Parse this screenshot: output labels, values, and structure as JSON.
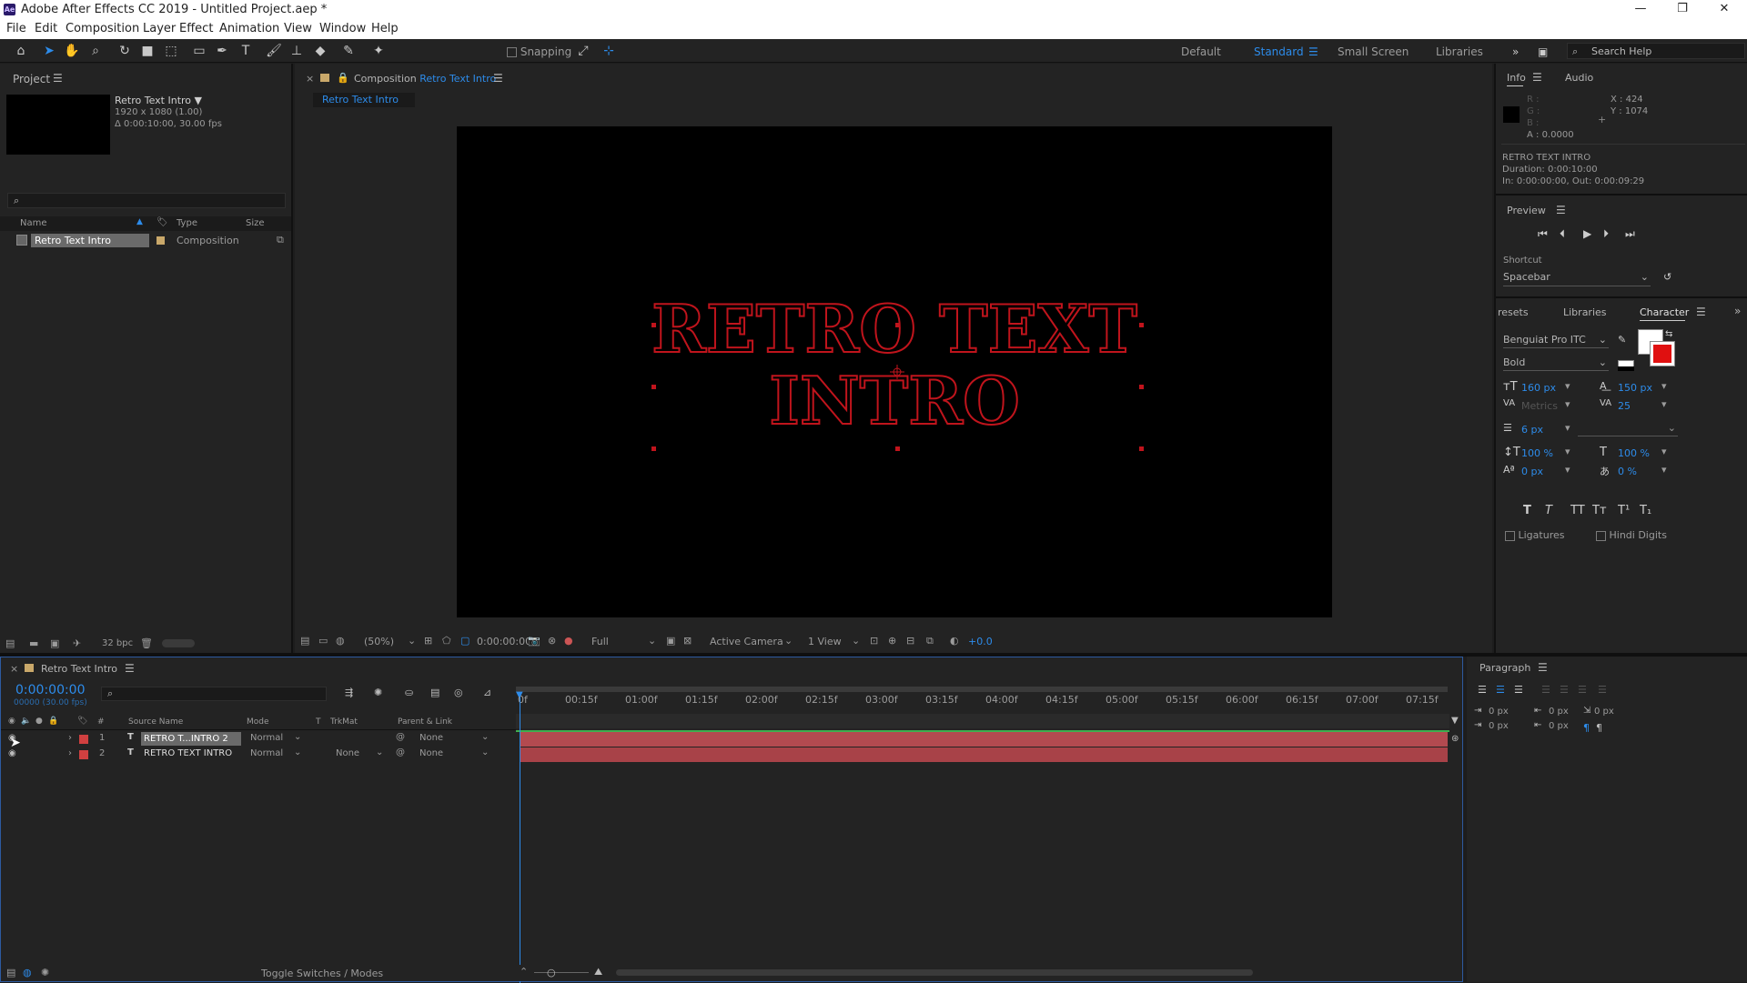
{
  "title_bar": {
    "logo": "Ae",
    "title": "Adobe After Effects CC 2019 - Untitled Project.aep *",
    "minimize": "—",
    "maximize": "❐",
    "close": "✕"
  },
  "menu": [
    "File",
    "Edit",
    "Composition",
    "Layer",
    "Effect",
    "Animation",
    "View",
    "Window",
    "Help"
  ],
  "toolbar": {
    "snapping": "Snapping",
    "workspaces": [
      "Default",
      "Standard",
      "Small Screen",
      "Libraries"
    ],
    "active_workspace": "Standard",
    "search_placeholder": "Search Help",
    "more": "»"
  },
  "project": {
    "tab": "Project",
    "item_name": "Retro Text Intro ▼",
    "item_res": "1920 x 1080 (1.00)",
    "item_dur": "Δ 0:00:10:00, 30.00 fps",
    "columns": {
      "name": "Name",
      "type": "Type",
      "size": "Size"
    },
    "rows": [
      {
        "name": "Retro Text Intro",
        "type": "Composition"
      }
    ],
    "bpc": "32 bpc"
  },
  "composition": {
    "tab_prefix": "Composition",
    "tab_name": "Retro Text Intro",
    "breadcrumb": "Retro Text Intro",
    "text_line1": "RETRO TEXT",
    "text_line2": "INTRO",
    "text_color": "#c0141c",
    "zoom": "(50%)",
    "timecode": "0:00:00:00",
    "resolution": "Full",
    "camera": "Active Camera",
    "views": "1 View",
    "exposure": "+0.0"
  },
  "info": {
    "tabs": [
      "Info",
      "Audio"
    ],
    "r": "R :",
    "g": "G :",
    "b": "B :",
    "a": "A : 0.0000",
    "x": "X : 424",
    "y": "Y : 1074",
    "comp_name": "RETRO TEXT INTRO",
    "duration": "Duration: 0:00:10:00",
    "inout": "In: 0:00:00:00, Out: 0:00:09:29"
  },
  "preview": {
    "tab": "Preview",
    "shortcut_label": "Shortcut",
    "shortcut_value": "Spacebar"
  },
  "character": {
    "tabs": [
      "resets",
      "Libraries",
      "Character"
    ],
    "font": "Benguiat Pro ITC",
    "style": "Bold",
    "size": "160 px",
    "leading": "150 px",
    "kerning": "Metrics",
    "tracking": "25",
    "stroke": "6 px",
    "vscale": "100 %",
    "hscale": "100 %",
    "baseline": "0 px",
    "tsume": "0 %",
    "styles": [
      "T",
      "T",
      "TT",
      "Tт",
      "T¹",
      "T₁"
    ],
    "ligatures": "Ligatures",
    "hindi": "Hindi Digits",
    "fill_color": "#ffffff",
    "stroke_color": "#e01010"
  },
  "paragraph": {
    "tab": "Paragraph",
    "values": [
      "0 px",
      "0 px",
      "0 px",
      "0 px",
      "0 px"
    ]
  },
  "timeline": {
    "tab": "Retro Text Intro",
    "timecode": "0:00:00:00",
    "fps": "00000 (30.00 fps)",
    "columns": {
      "num": "#",
      "source": "Source Name",
      "mode": "Mode",
      "t": "T",
      "trkmat": "TrkMat",
      "parent": "Parent & Link"
    },
    "layers": [
      {
        "num": "1",
        "name": "RETRO T...INTRO 2",
        "mode": "Normal",
        "trkmat": "",
        "parent": "None"
      },
      {
        "num": "2",
        "name": "RETRO TEXT INTRO",
        "mode": "Normal",
        "trkmat": "None",
        "parent": "None"
      }
    ],
    "ruler": [
      "0f",
      "00:15f",
      "01:00f",
      "01:15f",
      "02:00f",
      "02:15f",
      "03:00f",
      "03:15f",
      "04:00f",
      "04:15f",
      "05:00f",
      "05:15f",
      "06:00f",
      "06:15f",
      "07:00f",
      "07:15f"
    ],
    "toggle": "Toggle Switches / Modes",
    "bar_color": "#b34a50"
  }
}
